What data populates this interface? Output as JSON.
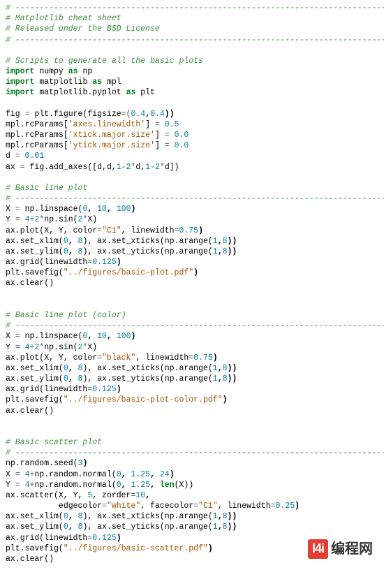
{
  "header": {
    "rule": "# -----------------------------------------------------------------------------",
    "l1": "# Matplotlib cheat sheet",
    "l2": "# Released under the BSD License",
    "rule2": "# -----------------------------------------------------------------------------"
  },
  "sec1": {
    "title": "# Scripts to generate all the basic plots",
    "imp1a": "import",
    "imp1b": "numpy",
    "imp1c": "as",
    "imp1d": "np",
    "imp2a": "import",
    "imp2b": "matplotlib",
    "imp2c": "as",
    "imp2d": "mpl",
    "imp3a": "import",
    "imp3b": "matplotlib.pyplot",
    "imp3c": "as",
    "imp3d": "plt"
  },
  "setup": {
    "l1_a": "fig ",
    "l1_eq": "=",
    "l1_b": " plt.figure(figsize",
    "l1_c": "=(",
    "l1_n1": "0.4",
    "l1_comma": ",",
    "l1_n2": "0.4",
    "l1_end": "))",
    "l2_a": "mpl.rcParams[",
    "l2_s": "'axes.linewidth'",
    "l2_b": "] ",
    "l2_eq": "=",
    "l2_n": " 0.5",
    "l3_a": "mpl.rcParams[",
    "l3_s": "'xtick.major.size'",
    "l3_b": "] ",
    "l3_eq": "=",
    "l3_n": " 0.0",
    "l4_a": "mpl.rcParams[",
    "l4_s": "'ytick.major.size'",
    "l4_b": "] ",
    "l4_eq": "=",
    "l4_n": " 0.0",
    "l5_a": "d ",
    "l5_eq": "=",
    "l5_n": " 0.01",
    "l6_a": "ax ",
    "l6_eq": "=",
    "l6_b": " fig.add_axes([d,d,",
    "l6_n1": "1",
    "l6_m1": "-",
    "l6_n2": "2",
    "l6_m2": "*",
    "l6_c1": "d,",
    "l6_n3": "1",
    "l6_m3": "-",
    "l6_n4": "2",
    "l6_m4": "*",
    "l6_c2": "d])"
  },
  "basicLine": {
    "title": "# Basic line plot",
    "rule": "# -----------------------------------------------------------------------------",
    "l1_a": "X ",
    "l1_eq": "=",
    "l1_b": " np.linspace(",
    "l1_n1": "0",
    "l1_c1": ", ",
    "l1_n2": "10",
    "l1_c2": ", ",
    "l1_n3": "100",
    "l1_end": ")",
    "l2_a": "Y ",
    "l2_eq": "=",
    "l2_b": " ",
    "l2_n1": "4",
    "l2_p": "+",
    "l2_n2": "2",
    "l2_m": "*",
    "l2_c": "np.sin(",
    "l2_n3": "2",
    "l2_m2": "*",
    "l2_d": "X)",
    "l3_a": "ax.plot(X, Y, color",
    "l3_eq": "=",
    "l3_s": "\"C1\"",
    "l3_b": ", linewidth",
    "l3_eq2": "=",
    "l3_n": "0.75",
    "l3_end": ")",
    "l4_a": "ax.set_xlim(",
    "l4_n1": "0",
    "l4_c1": ", ",
    "l4_n2": "8",
    "l4_b": "), ax.set_xticks(np.arange(",
    "l4_n3": "1",
    "l4_c2": ",",
    "l4_n4": "8",
    "l4_end": "))",
    "l5_a": "ax.set_ylim(",
    "l5_n1": "0",
    "l5_c1": ", ",
    "l5_n2": "8",
    "l5_b": "), ax.set_yticks(np.arange(",
    "l5_n3": "1",
    "l5_c2": ",",
    "l5_n4": "8",
    "l5_end": "))",
    "l6_a": "ax.grid(linewidth",
    "l6_eq": "=",
    "l6_n": "0.125",
    "l6_end": ")",
    "l7_a": "plt.savefig(",
    "l7_s": "\"../figures/basic-plot.pdf\"",
    "l7_end": ")",
    "l8": "ax.clear()"
  },
  "basicColor": {
    "title": "# Basic line plot (color)",
    "rule": "# -----------------------------------------------------------------------------",
    "l1_a": "X ",
    "l1_eq": "=",
    "l1_b": " np.linspace(",
    "l1_n1": "0",
    "l1_c1": ", ",
    "l1_n2": "10",
    "l1_c2": ", ",
    "l1_n3": "100",
    "l1_end": ")",
    "l2_a": "Y ",
    "l2_eq": "=",
    "l2_b": " ",
    "l2_n1": "4",
    "l2_p": "+",
    "l2_n2": "2",
    "l2_m": "*",
    "l2_c": "np.sin(",
    "l2_n3": "2",
    "l2_m2": "*",
    "l2_d": "X)",
    "l3_a": "ax.plot(X, Y, color",
    "l3_eq": "=",
    "l3_s": "\"black\"",
    "l3_b": ", linewidth",
    "l3_eq2": "=",
    "l3_n": "0.75",
    "l3_end": ")",
    "l4_a": "ax.set_xlim(",
    "l4_n1": "0",
    "l4_c1": ", ",
    "l4_n2": "8",
    "l4_b": "), ax.set_xticks(np.arange(",
    "l4_n3": "1",
    "l4_c2": ",",
    "l4_n4": "8",
    "l4_end": "))",
    "l5_a": "ax.set_ylim(",
    "l5_n1": "0",
    "l5_c1": ", ",
    "l5_n2": "8",
    "l5_b": "), ax.set_yticks(np.arange(",
    "l5_n3": "1",
    "l5_c2": ",",
    "l5_n4": "8",
    "l5_end": "))",
    "l6_a": "ax.grid(linewidth",
    "l6_eq": "=",
    "l6_n": "0.125",
    "l6_end": ")",
    "l7_a": "plt.savefig(",
    "l7_s": "\"../figures/basic-plot-color.pdf\"",
    "l7_end": ")",
    "l8": "ax.clear()"
  },
  "basicScatter": {
    "title": "# Basic scatter plot",
    "rule": "# -----------------------------------------------------------------------------",
    "l1_a": "np.random.seed(",
    "l1_n": "3",
    "l1_end": ")",
    "l2_a": "X ",
    "l2_eq": "=",
    "l2_b": " ",
    "l2_n1": "4",
    "l2_p": "+",
    "l2_c": "np.random.normal(",
    "l2_n2": "0",
    "l2_c1": ", ",
    "l2_n3": "1.25",
    "l2_c2": ", ",
    "l2_n4": "24",
    "l2_end": ")",
    "l3_a": "Y ",
    "l3_eq": "=",
    "l3_b": " ",
    "l3_n1": "4",
    "l3_p": "+",
    "l3_c": "np.random.normal(",
    "l3_n2": "0",
    "l3_c1": ", ",
    "l3_n3": "1.25",
    "l3_c2": ", ",
    "l3_len": "len",
    "l3_d": "(X))",
    "l4_a": "ax.scatter(X, Y, ",
    "l4_n1": "5",
    "l4_b": ", zorder",
    "l4_eq": "=",
    "l4_n2": "10",
    "l4_end": ",",
    "l5_a": "           edgecolor",
    "l5_eq": "=",
    "l5_s1": "\"white\"",
    "l5_b": ", facecolor",
    "l5_eq2": "=",
    "l5_s2": "\"C1\"",
    "l5_c": ", linewidth",
    "l5_eq3": "=",
    "l5_n": "0.25",
    "l5_end": ")",
    "l6_a": "ax.set_xlim(",
    "l6_n1": "0",
    "l6_c1": ", ",
    "l6_n2": "8",
    "l6_b": "), ax.set_xticks(np.arange(",
    "l6_n3": "1",
    "l6_c2": ",",
    "l6_n4": "8",
    "l6_end": "))",
    "l7_a": "ax.set_ylim(",
    "l7_n1": "0",
    "l7_c1": ", ",
    "l7_n2": "8",
    "l7_b": "), ax.set_yticks(np.arange(",
    "l7_n3": "1",
    "l7_c2": ",",
    "l7_n4": "8",
    "l7_end": "))",
    "l8_a": "ax.grid(linewidth",
    "l8_eq": "=",
    "l8_n": "0.125",
    "l8_end": ")",
    "l9_a": "plt.savefig(",
    "l9_s": "\"../figures/basic-scatter.pdf\"",
    "l9_end": ")",
    "l10": "ax.clear()"
  },
  "watermark": {
    "logo": "l4i",
    "text": "编程网"
  }
}
